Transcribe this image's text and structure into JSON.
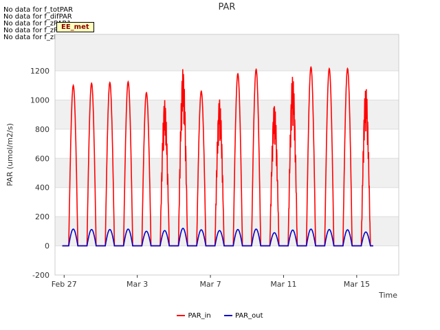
{
  "notes": [
    "No data for f_totPAR",
    "No data for f_difPAR",
    "No data for f_zPAR1",
    "No data for f_zPAR2",
    "No data for f_zPAR3"
  ],
  "badge": "EE_met",
  "colors": {
    "PAR_in": "#ff0000",
    "PAR_out": "#0000cc",
    "plot_bg_band": "#f0f0f0",
    "grid": "#dddddd"
  },
  "chart_data": {
    "type": "line",
    "title": "PAR",
    "xlabel": "Time",
    "ylabel": "PAR (umol/m2/s)",
    "ylim": [
      -200,
      1450
    ],
    "xlim_days": [
      -0.5,
      18.3
    ],
    "yticks": [
      -200,
      0,
      200,
      400,
      600,
      800,
      1000,
      1200
    ],
    "xticks": [
      {
        "day": 0,
        "label": "Feb 27"
      },
      {
        "day": 4,
        "label": "Mar 3"
      },
      {
        "day": 8,
        "label": "Mar 7"
      },
      {
        "day": 12,
        "label": "Mar 11"
      },
      {
        "day": 16,
        "label": "Mar 15"
      }
    ],
    "grid": true,
    "legend_position": "bottom-center",
    "series": [
      {
        "name": "PAR_in",
        "daily_peaks": [
          1100,
          1115,
          1120,
          1125,
          1050,
          1000,
          1215,
          1060,
          1010,
          1180,
          1210,
          975,
          1175,
          1225,
          1215,
          1215,
          1095
        ]
      },
      {
        "name": "PAR_out",
        "daily_peaks": [
          115,
          112,
          112,
          115,
          100,
          105,
          120,
          110,
          105,
          112,
          115,
          90,
          108,
          115,
          112,
          110,
          95
        ]
      }
    ],
    "day_start": 0.5,
    "day_length": 0.5
  }
}
